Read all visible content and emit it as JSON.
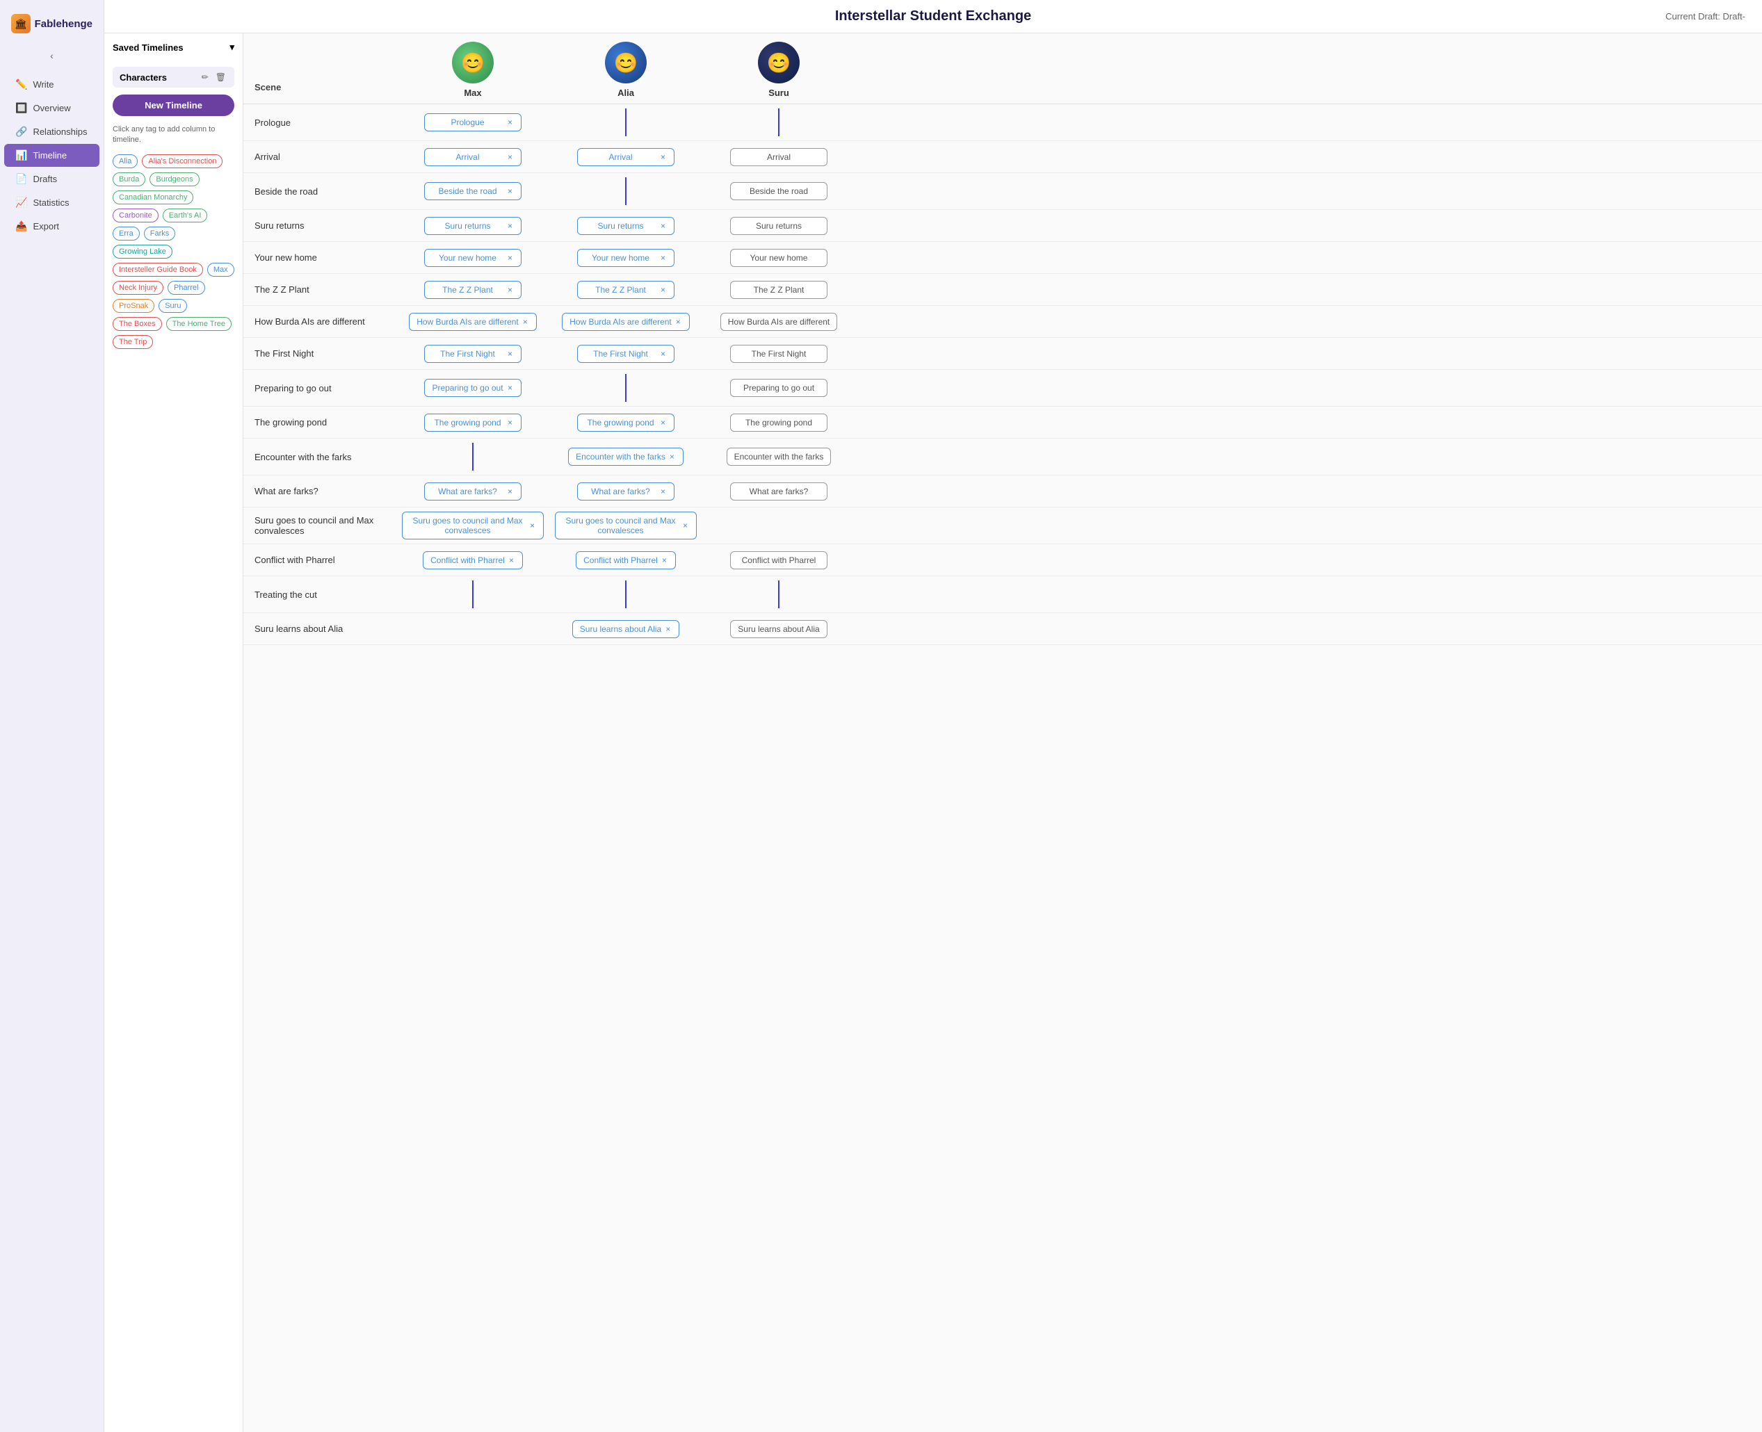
{
  "app": {
    "name": "Fablehenge",
    "title": "Interstellar Student Exchange",
    "draft_label": "Current Draft: Draft-"
  },
  "nav": {
    "collapse_label": "‹",
    "items": [
      {
        "id": "write",
        "label": "Write",
        "icon": "✏️",
        "active": false
      },
      {
        "id": "overview",
        "label": "Overview",
        "icon": "🔲",
        "active": false
      },
      {
        "id": "relationships",
        "label": "Relationships",
        "icon": "🔗",
        "active": false
      },
      {
        "id": "timeline",
        "label": "Timeline",
        "icon": "📊",
        "active": true
      },
      {
        "id": "drafts",
        "label": "Drafts",
        "icon": "📄",
        "active": false
      },
      {
        "id": "statistics",
        "label": "Statistics",
        "icon": "📈",
        "active": false
      },
      {
        "id": "export",
        "label": "Export",
        "icon": "📤",
        "active": false
      }
    ]
  },
  "left_panel": {
    "saved_timelines_label": "Saved Timelines",
    "characters_label": "Characters",
    "new_timeline_label": "New Timeline",
    "hint_text": "Click any tag to add column to timeline.",
    "tags": [
      {
        "label": "Alia",
        "color": "blue"
      },
      {
        "label": "Alia's Disconnection",
        "color": "red"
      },
      {
        "label": "Burda",
        "color": "green"
      },
      {
        "label": "Burdgeons",
        "color": "green"
      },
      {
        "label": "Canadian Monarchy",
        "color": "green"
      },
      {
        "label": "Carbonite",
        "color": "purple"
      },
      {
        "label": "Earth's AI",
        "color": "green"
      },
      {
        "label": "Erra",
        "color": "blue"
      },
      {
        "label": "Farks",
        "color": "blue"
      },
      {
        "label": "Growing Lake",
        "color": "teal"
      },
      {
        "label": "Intersteller Guide Book",
        "color": "red"
      },
      {
        "label": "Max",
        "color": "blue"
      },
      {
        "label": "Neck Injury",
        "color": "red"
      },
      {
        "label": "Pharrel",
        "color": "blue"
      },
      {
        "label": "ProSnak",
        "color": "orange"
      },
      {
        "label": "Suru",
        "color": "blue"
      },
      {
        "label": "The Boxes",
        "color": "red"
      },
      {
        "label": "The Home Tree",
        "color": "green"
      },
      {
        "label": "The Trip",
        "color": "red"
      }
    ]
  },
  "characters": [
    {
      "id": "max",
      "name": "Max",
      "avatar_class": "avatar-max",
      "face": "😊"
    },
    {
      "id": "alia",
      "name": "Alia",
      "avatar_class": "avatar-alia",
      "face": "😊"
    },
    {
      "id": "suru",
      "name": "Suru",
      "avatar_class": "avatar-suru",
      "face": "😊"
    }
  ],
  "scenes": [
    {
      "label": "Prologue",
      "cells": [
        {
          "char": "max",
          "text": "Prologue",
          "has_tag": true
        },
        {
          "char": "alia",
          "text": "",
          "has_tag": false,
          "line": true
        },
        {
          "char": "suru",
          "text": "",
          "has_tag": false,
          "line": true
        }
      ]
    },
    {
      "label": "Arrival",
      "cells": [
        {
          "char": "max",
          "text": "Arrival",
          "has_tag": true
        },
        {
          "char": "alia",
          "text": "Arrival",
          "has_tag": true
        },
        {
          "char": "suru",
          "text": "Arrival",
          "has_tag": false,
          "plain": true
        }
      ]
    },
    {
      "label": "Beside the road",
      "cells": [
        {
          "char": "max",
          "text": "Beside the road",
          "has_tag": true
        },
        {
          "char": "alia",
          "text": "",
          "has_tag": false,
          "line": true
        },
        {
          "char": "suru",
          "text": "Beside the road",
          "has_tag": false,
          "plain": true
        }
      ]
    },
    {
      "label": "Suru returns",
      "cells": [
        {
          "char": "max",
          "text": "Suru returns",
          "has_tag": true
        },
        {
          "char": "alia",
          "text": "Suru returns",
          "has_tag": true
        },
        {
          "char": "suru",
          "text": "Suru returns",
          "has_tag": false,
          "plain": true
        }
      ]
    },
    {
      "label": "Your new home",
      "cells": [
        {
          "char": "max",
          "text": "Your new home",
          "has_tag": true
        },
        {
          "char": "alia",
          "text": "Your new home",
          "has_tag": true
        },
        {
          "char": "suru",
          "text": "Your new home",
          "has_tag": false,
          "plain": true
        }
      ]
    },
    {
      "label": "The Z Z Plant",
      "cells": [
        {
          "char": "max",
          "text": "The Z Z Plant",
          "has_tag": true
        },
        {
          "char": "alia",
          "text": "The Z Z Plant",
          "has_tag": true
        },
        {
          "char": "suru",
          "text": "The Z Z Plant",
          "has_tag": false,
          "plain": true
        }
      ]
    },
    {
      "label": "How Burda AIs are different",
      "cells": [
        {
          "char": "max",
          "text": "How Burda AIs are different",
          "has_tag": true
        },
        {
          "char": "alia",
          "text": "How Burda AIs are different",
          "has_tag": true
        },
        {
          "char": "suru",
          "text": "How Burda AIs are different",
          "has_tag": false,
          "plain": true
        }
      ]
    },
    {
      "label": "The First Night",
      "cells": [
        {
          "char": "max",
          "text": "The First Night",
          "has_tag": true
        },
        {
          "char": "alia",
          "text": "The First Night",
          "has_tag": true
        },
        {
          "char": "suru",
          "text": "The First Night",
          "has_tag": false,
          "plain": true
        }
      ]
    },
    {
      "label": "Preparing to go out",
      "cells": [
        {
          "char": "max",
          "text": "Preparing to go out",
          "has_tag": true
        },
        {
          "char": "alia",
          "text": "",
          "has_tag": false,
          "line": true
        },
        {
          "char": "suru",
          "text": "Preparing to go out",
          "has_tag": false,
          "plain": true
        }
      ]
    },
    {
      "label": "The growing pond",
      "cells": [
        {
          "char": "max",
          "text": "The growing pond",
          "has_tag": true
        },
        {
          "char": "alia",
          "text": "The growing pond",
          "has_tag": true
        },
        {
          "char": "suru",
          "text": "The growing pond",
          "has_tag": false,
          "plain": true
        }
      ]
    },
    {
      "label": "Encounter with the farks",
      "cells": [
        {
          "char": "max",
          "text": "",
          "has_tag": false,
          "line": true
        },
        {
          "char": "alia",
          "text": "Encounter with the farks",
          "has_tag": true
        },
        {
          "char": "suru",
          "text": "Encounter with the farks",
          "has_tag": false,
          "plain": true
        }
      ]
    },
    {
      "label": "What are farks?",
      "cells": [
        {
          "char": "max",
          "text": "What are farks?",
          "has_tag": true
        },
        {
          "char": "alia",
          "text": "What are farks?",
          "has_tag": true
        },
        {
          "char": "suru",
          "text": "What are farks?",
          "has_tag": false,
          "plain": true
        }
      ]
    },
    {
      "label": "Suru goes to council and Max convalesces",
      "cells": [
        {
          "char": "max",
          "text": "Suru goes to council and Max convalesces",
          "has_tag": true
        },
        {
          "char": "alia",
          "text": "Suru goes to council and Max convalesces",
          "has_tag": true
        },
        {
          "char": "suru",
          "text": "",
          "has_tag": false,
          "line": false,
          "empty": true
        }
      ]
    },
    {
      "label": "Conflict with Pharrel",
      "cells": [
        {
          "char": "max",
          "text": "Conflict with Pharrel",
          "has_tag": true
        },
        {
          "char": "alia",
          "text": "Conflict with Pharrel",
          "has_tag": true
        },
        {
          "char": "suru",
          "text": "Conflict with Pharrel",
          "has_tag": false,
          "plain": true
        }
      ]
    },
    {
      "label": "Treating the cut",
      "cells": [
        {
          "char": "max",
          "text": "",
          "has_tag": false,
          "line": true
        },
        {
          "char": "alia",
          "text": "",
          "has_tag": false,
          "line": true
        },
        {
          "char": "suru",
          "text": "",
          "has_tag": false,
          "line": true
        }
      ]
    },
    {
      "label": "Suru learns about Alia",
      "cells": [
        {
          "char": "max",
          "text": "",
          "has_tag": false,
          "empty": true
        },
        {
          "char": "alia",
          "text": "Suru learns about Alia",
          "has_tag": true
        },
        {
          "char": "suru",
          "text": "Suru learns about Alia",
          "has_tag": false,
          "plain": true
        }
      ]
    }
  ],
  "scene_col_header": "Scene"
}
